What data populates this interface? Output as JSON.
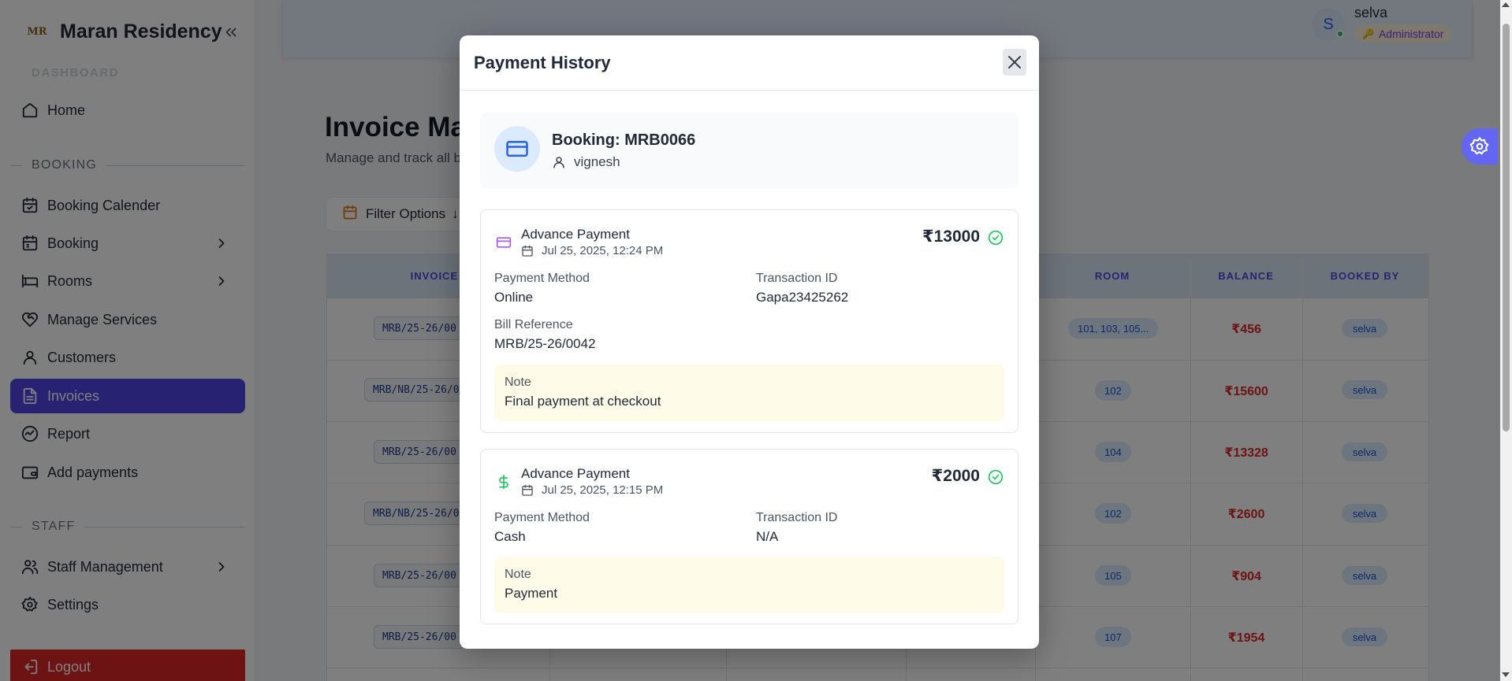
{
  "app": {
    "brand_name": "Maran Residency",
    "brand_logo_text": "MR"
  },
  "sidebar": {
    "faded_section": "DASHBOARD",
    "home": "Home",
    "booking_section": "BOOKING",
    "booking_calendar": "Booking Calender",
    "booking": "Booking",
    "rooms": "Rooms",
    "manage_services": "Manage Services",
    "customers": "Customers",
    "invoices": "Invoices",
    "report": "Report",
    "add_payments": "Add payments",
    "staff_section": "STAFF",
    "staff_management": "Staff Management",
    "settings": "Settings",
    "logout": "Logout"
  },
  "header": {
    "avatar_initial": "S",
    "user_name": "selva",
    "role": "Administrator"
  },
  "page": {
    "title": "Invoice Ma",
    "subtitle": "Manage and track all b",
    "filter_label": "Filter Options",
    "filter_arrow": "↓"
  },
  "table": {
    "headers": {
      "invoice": "INVOICE I",
      "room": "ROOM",
      "balance": "BALANCE",
      "booked_by": "BOOKED BY"
    },
    "rows": [
      {
        "invoice": "MRB/25-26/00",
        "room": "101, 103, 105...",
        "balance": "₹456",
        "booked_by": "selva"
      },
      {
        "invoice": "MRB/NB/25-26/0",
        "room": "102",
        "balance": "₹15600",
        "booked_by": "selva"
      },
      {
        "invoice": "MRB/25-26/00",
        "room": "104",
        "balance": "₹13328",
        "booked_by": "selva"
      },
      {
        "invoice": "MRB/NB/25-26/0",
        "room": "102",
        "balance": "₹2600",
        "booked_by": "selva"
      },
      {
        "invoice": "MRB/25-26/00",
        "room": "105",
        "balance": "₹904",
        "booked_by": "selva"
      },
      {
        "invoice": "MRB/25-26/00",
        "room": "107",
        "balance": "₹1954",
        "booked_by": "selva"
      }
    ]
  },
  "modal": {
    "title": "Payment History",
    "booking_title": "Booking: MRB0066",
    "guest_name": "vignesh",
    "payments": [
      {
        "type": "Advance Payment",
        "date": "Jul 25, 2025, 12:24 PM",
        "amount": "₹13000",
        "method_label": "Payment Method",
        "method": "Online",
        "txn_label": "Transaction ID",
        "txn": "Gapa23425262",
        "bill_label": "Bill Reference",
        "bill": "MRB/25-26/0042",
        "note_label": "Note",
        "note": "Final payment at checkout"
      },
      {
        "type": "Advance Payment",
        "date": "Jul 25, 2025, 12:15 PM",
        "amount": "₹2000",
        "method_label": "Payment Method",
        "method": "Cash",
        "txn_label": "Transaction ID",
        "txn": "N/A",
        "note_label": "Note",
        "note": "Payment"
      }
    ]
  },
  "colors": {
    "accent": "#4f46e5",
    "logout": "#dc2626",
    "success": "#22c55e",
    "balance": "#dc2626"
  }
}
